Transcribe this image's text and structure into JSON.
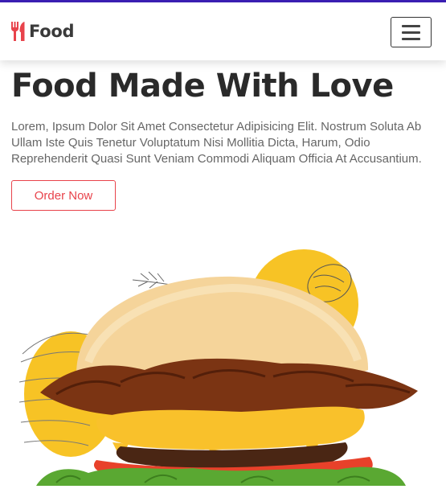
{
  "header": {
    "logo_text": "Food",
    "logo_icon": "fork-knife-icon",
    "menu_icon": "hamburger-menu-icon"
  },
  "hero": {
    "title": "Food Made With Love",
    "description": "Lorem, Ipsum Dolor Sit Amet Consectetur Adipisicing Elit. Nostrum Soluta Ab Ullam Iste Quis Tenetur Voluptatum Nisi Mollitia Dicta, Harum, Odio Reprehenderit Quasi Sunt Veniam Commodi Aliquam Officia At Accusantium.",
    "cta_label": "Order Now"
  },
  "colors": {
    "accent": "#e8434b",
    "top_border": "#3b1fb5",
    "illustration_yellow": "#f7c325"
  }
}
